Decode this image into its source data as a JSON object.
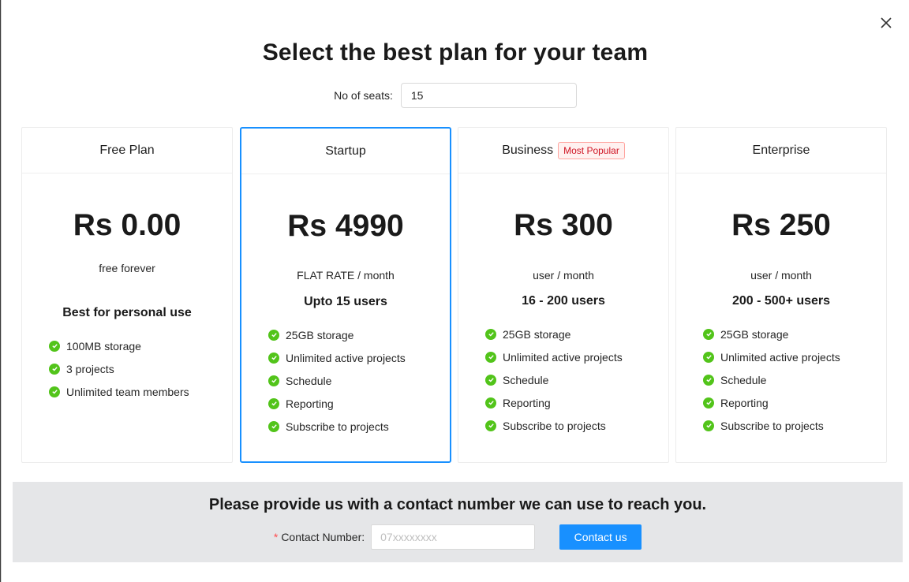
{
  "modal": {
    "title": "Select the best plan for your team",
    "close_icon": "close-icon"
  },
  "seats": {
    "label": "No of seats",
    "value": "15"
  },
  "plans": [
    {
      "name": "Free Plan",
      "badge": "",
      "price": "Rs 0.00",
      "rate": "free forever",
      "users": "Best for personal use",
      "features": [
        "100MB storage",
        "3 projects",
        "Unlimited team members"
      ]
    },
    {
      "name": "Startup",
      "badge": "",
      "price": "Rs 4990",
      "rate": "FLAT RATE / month",
      "users": "Upto 15 users",
      "features": [
        "25GB storage",
        "Unlimited active projects",
        "Schedule",
        "Reporting",
        "Subscribe to projects"
      ]
    },
    {
      "name": "Business",
      "badge": "Most Popular",
      "price": "Rs 300",
      "rate": "user / month",
      "users": "16 - 200 users",
      "features": [
        "25GB storage",
        "Unlimited active projects",
        "Schedule",
        "Reporting",
        "Subscribe to projects"
      ]
    },
    {
      "name": "Enterprise",
      "badge": "",
      "price": "Rs 250",
      "rate": "user / month",
      "users": "200 - 500+ users",
      "features": [
        "25GB storage",
        "Unlimited active projects",
        "Schedule",
        "Reporting",
        "Subscribe to projects"
      ]
    }
  ],
  "selected_plan": "Startup",
  "contact": {
    "title": "Please provide us with a contact number we can use to reach you.",
    "required_mark": "*",
    "label": "Contact Number",
    "placeholder": "07xxxxxxxx",
    "button_label": "Contact us"
  },
  "colors": {
    "accent": "#1890ff",
    "check": "#52c41a",
    "badge_text": "#cf1322",
    "panel_bg": "#e5e6e8"
  }
}
